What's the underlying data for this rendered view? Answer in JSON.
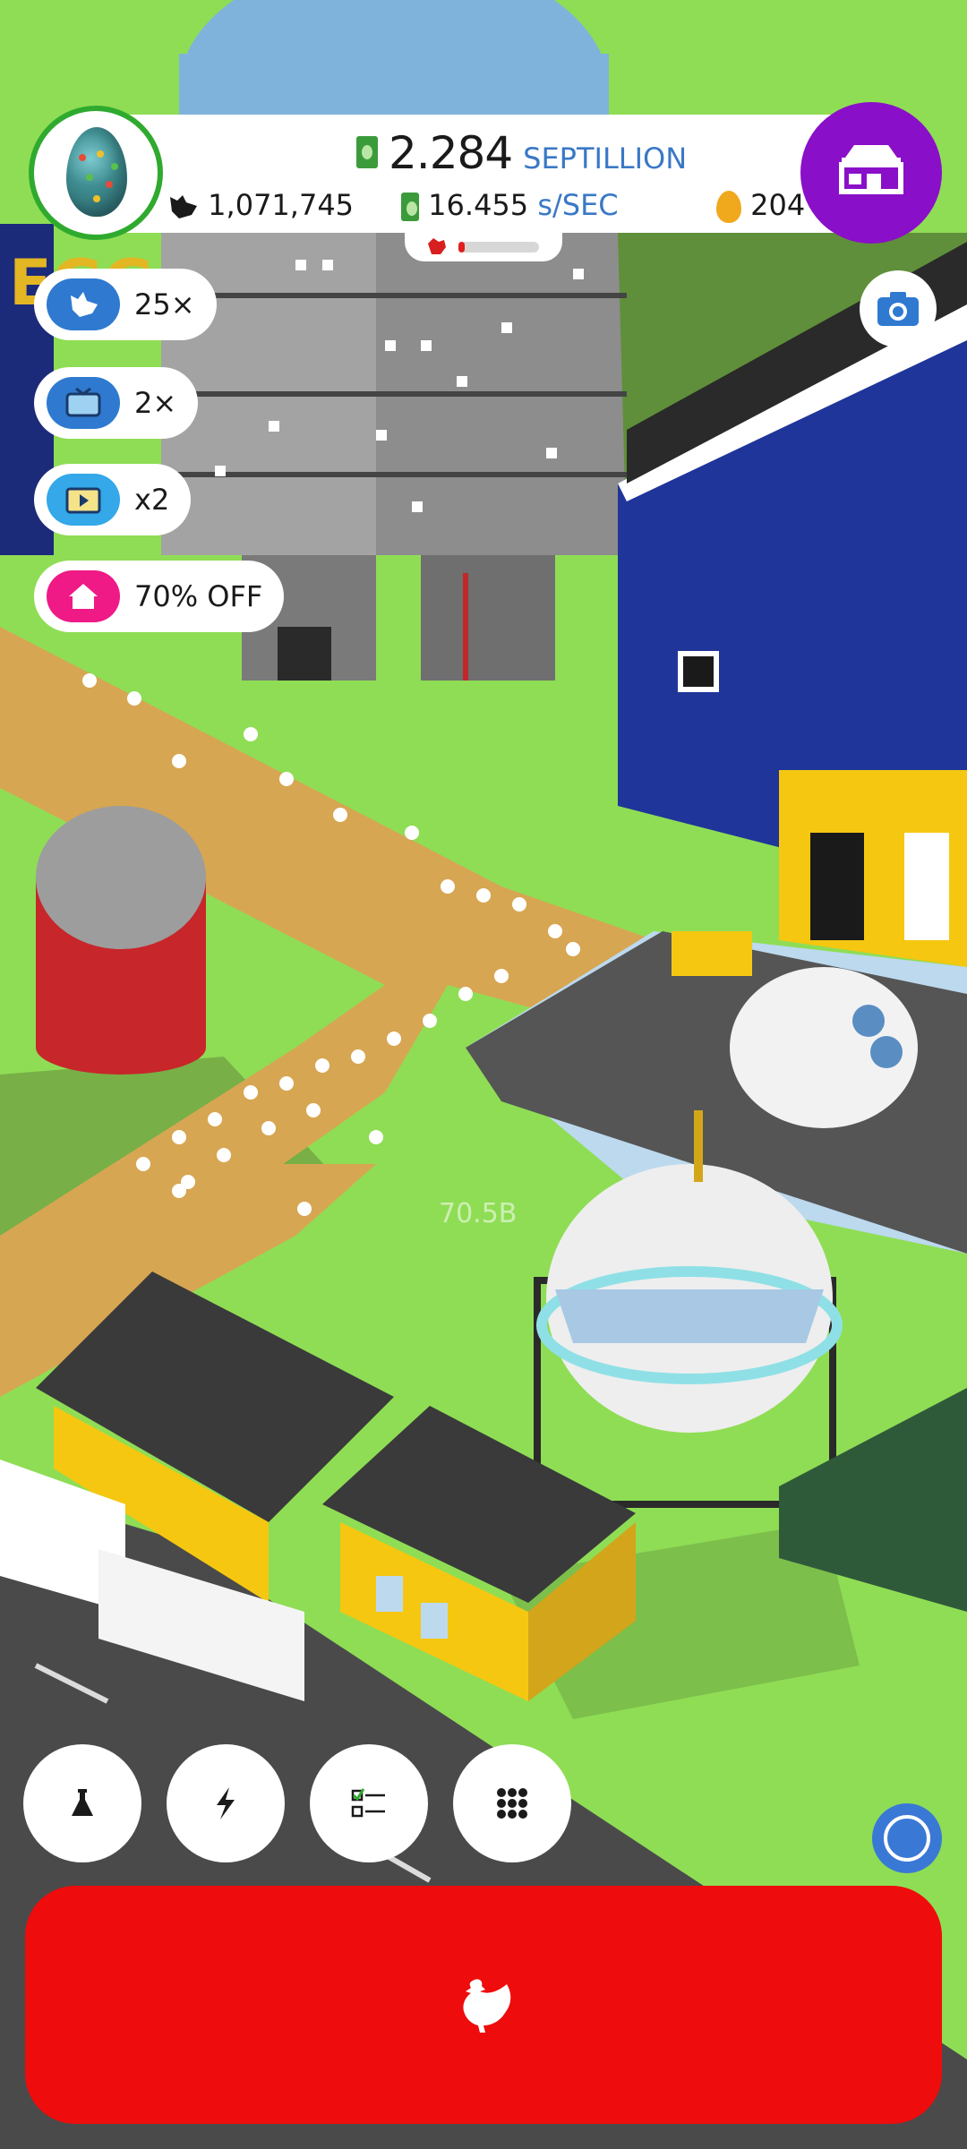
{
  "hud": {
    "cash_value": "2.284",
    "cash_unit": "SEPTILLION",
    "chicken_count": "1,071,745",
    "rate_value": "16.455",
    "rate_unit": "s/SEC",
    "golden_eggs": "204",
    "habitat_fill": 0.08
  },
  "boosts": [
    {
      "label": "25×",
      "icon": "chicken-icon",
      "color": "#2f7ad0"
    },
    {
      "label": "2×",
      "icon": "tv-icon",
      "color": "#2f7ad0"
    },
    {
      "label": "x2",
      "icon": "video-icon",
      "color": "#34a8e8"
    },
    {
      "label": "70% OFF",
      "icon": "house-icon",
      "color": "#ef1a86"
    }
  ],
  "bottom_buttons": [
    "flask-icon",
    "lightning-icon",
    "checklist-icon",
    "grid-icon"
  ],
  "scene_overlay_text": "70.5B",
  "colors": {
    "hatch": "#ee0c0c",
    "shop": "#8a0fc8",
    "grass": "#8fdd55",
    "accent_blue": "#3a78c6"
  }
}
